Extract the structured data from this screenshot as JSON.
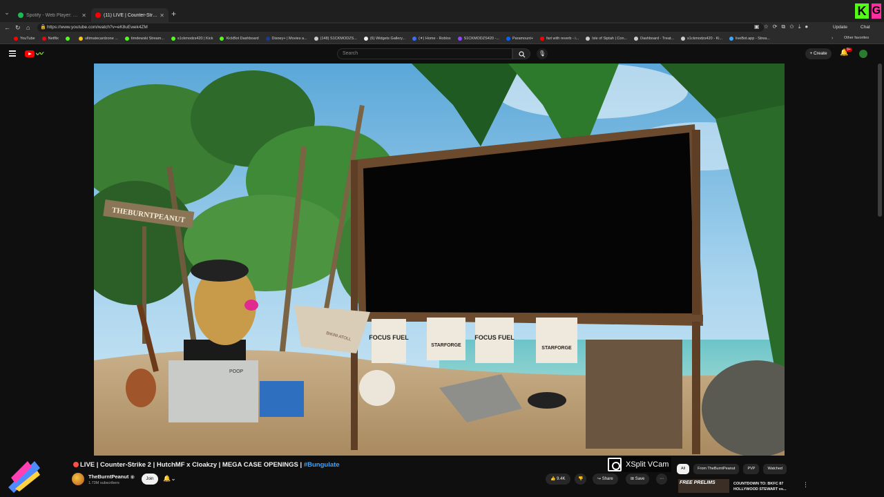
{
  "browser": {
    "tabs": [
      {
        "title": "Spotify - Web Player: Music for e",
        "color": "#1db954"
      },
      {
        "title": "(11) LIVE | Counter-Strike 2",
        "color": "#ff0000"
      }
    ],
    "url": "https://www.youtube.com/watch?v=eK8uEwek4ZM",
    "update_label": "Update",
    "chat_label": "Chat",
    "bookmarks": [
      {
        "label": "YouTube",
        "color": "#ff0000"
      },
      {
        "label": "Netflix",
        "color": "#e50914"
      },
      {
        "label": "",
        "color": "#53fc18"
      },
      {
        "label": "ultimatecardzone ...",
        "color": "#f5c518"
      },
      {
        "label": "timdewski Stream...",
        "color": "#53fc18"
      },
      {
        "label": "s1ckmodzs420 | Kick",
        "color": "#53fc18"
      },
      {
        "label": "KickBot Dashboard",
        "color": "#53fc18"
      },
      {
        "label": "Disney+ | Movies a...",
        "color": "#1a3b8f"
      },
      {
        "label": "(148) S1CKMODZS...",
        "color": "#cccccc"
      },
      {
        "label": "(6) Widgets Gallery...",
        "color": "#eeeeee"
      },
      {
        "label": "(✦) Home - Roblox",
        "color": "#3b6cff"
      },
      {
        "label": "S1CKMODZS420 -...",
        "color": "#9146ff"
      },
      {
        "label": "Paramount+",
        "color": "#0064ff"
      },
      {
        "label": "fart with reverb - i...",
        "color": "#ff0000"
      },
      {
        "label": "Isle of Siptah | Con...",
        "color": "#cccccc"
      },
      {
        "label": "Dashboard - Treat...",
        "color": "#cccccc"
      },
      {
        "label": "s1ckmodzs420 - Ki...",
        "color": "#cccccc"
      },
      {
        "label": "liveBot.app - Strea...",
        "color": "#3ea6ff"
      }
    ],
    "other_favorites": "Other favorites"
  },
  "masthead": {
    "search_placeholder": "Search",
    "create_label": "Create",
    "notif_count": "9+"
  },
  "video": {
    "title": "LIVE | Counter-Strike 2 | HutchMF x Cloakzy | MEGA CASE OPENINGS |",
    "hashtag": "#Bungulate",
    "channel": "TheBurntPeanut",
    "subscribers": "1.73M subscribers",
    "join_label": "Join",
    "like_count": "9.4K",
    "share_label": "Share",
    "save_label": "Save",
    "scene": {
      "sign": "THEBURNTPEANUT",
      "banners": [
        "FOCUS FUEL",
        "STARFORGE",
        "FOCUS FUEL",
        "STARFORGE"
      ],
      "boat_name": "BIKINI ATOLL",
      "crate_label": "POOP"
    },
    "xsplit_label": "XSplit VCam"
  },
  "sidebar": {
    "chips": [
      "All",
      "From TheBurntPeanut",
      "PVP",
      "Watched"
    ],
    "rec_thumb_text": "FREE PRELIMS",
    "rec_title_line1": "COUNTDOWN TO: BKFC 87",
    "rec_title_line2": "HOLLYWOOD STEWART vs..."
  }
}
